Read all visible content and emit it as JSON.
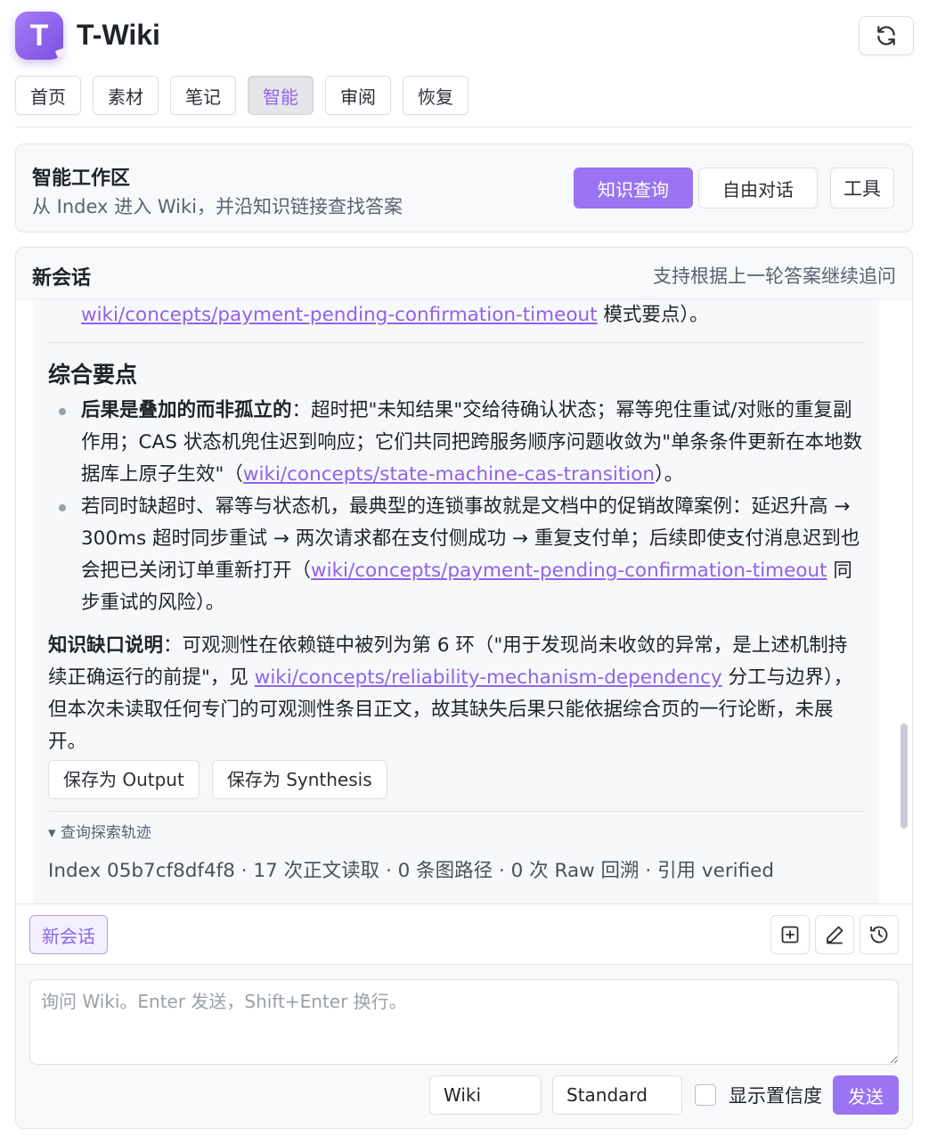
{
  "app": {
    "logo_letter": "T",
    "title": "T-Wiki"
  },
  "nav": {
    "tabs": [
      "首页",
      "素材",
      "笔记",
      "智能",
      "审阅",
      "恢复"
    ],
    "active": "智能"
  },
  "workspace": {
    "title": "智能工作区",
    "subtitle": "从 Index 进入 Wiki，并沿知识链接查找答案",
    "modes": [
      "知识查询",
      "自由对话"
    ],
    "active_mode": "知识查询",
    "tools_label": "工具"
  },
  "chat": {
    "title": "新会话",
    "hint": "支持根据上一轮答案继续追问",
    "answer": {
      "cont_link": "wiki/concepts/payment-pending-confirmation-timeout",
      "cont_suffix": " 模式要点）。",
      "section_heading": "综合要点",
      "point1": {
        "bold": "后果是叠加的而非孤立的",
        "text": "：超时把\"未知结果\"交给待确认状态；幂等兜住重试/对账的重复副作用；CAS 状态机兜住迟到响应；它们共同把跨服务顺序问题收敛为\"单条条件更新在本地数据库上原子生效\"（",
        "link": "wiki/concepts/state-machine-cas-transition",
        "suffix": "）。"
      },
      "point2": {
        "text": "若同时缺超时、幂等与状态机，最典型的连锁事故就是文档中的促销故障案例：延迟升高 → 300ms 超时同步重试 → 两次请求都在支付侧成功 → 重复支付单；后续即使支付消息迟到也会把已关闭订单重新打开（",
        "link": "wiki/concepts/payment-pending-confirmation-timeout",
        "suffix": " 同步重试的风险）。"
      },
      "gap_note": {
        "bold": "知识缺口说明",
        "text": "：可观测性在依赖链中被列为第 6 环（\"用于发现尚未收敛的异常，是上述机制持续正确运行的前提\"，见 ",
        "link": "wiki/concepts/reliability-mechanism-dependency",
        "suffix": " 分工与边界），但本次未读取任何专门的可观测性条目正文，故其缺失后果只能依据综合页的一行论断，未展开。"
      },
      "save_buttons": [
        "保存为 Output",
        "保存为 Synthesis"
      ],
      "trace_toggle": "▾ 查询探索轨迹",
      "trace_stats": "Index 05b7cf8df4f8 · 17 次正文读取 · 0 条图路径 · 0 次 Raw 回溯 · 引用 verified"
    },
    "new_chat_tag": "新会话",
    "composer": {
      "placeholder": "询问 Wiki。Enter 发送，Shift+Enter 换行。",
      "scope": "Wiki",
      "depth": "Standard",
      "show_confidence_label": "显示置信度",
      "show_confidence": false,
      "send_label": "发送"
    }
  },
  "colors": {
    "accent": "#9a74f2",
    "link": "#8f63e8"
  }
}
